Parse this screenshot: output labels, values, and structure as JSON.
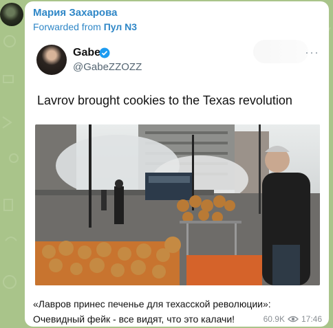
{
  "message": {
    "sender_name": "Мария Захарова",
    "forwarded_prefix": "Forwarded from",
    "forwarded_source": "Пул N3",
    "tweet": {
      "author_name": "Gabe",
      "author_handle": "@GabeZZOZZ",
      "text": "Lavrov brought cookies to the Texas revolution",
      "more_icon": "more-dots-icon",
      "verified_icon": "verified-badge-icon"
    },
    "caption_line1": "«Лавров принес печенье для техасской революции»:",
    "caption_line2": "Очевидный фейк - все видят, что это калачи!",
    "views": "60.9K",
    "time": "17:46"
  },
  "colors": {
    "chat_background": "#a9c48a",
    "link_blue": "#2f87c7",
    "verified_blue": "#1d9bf0"
  }
}
